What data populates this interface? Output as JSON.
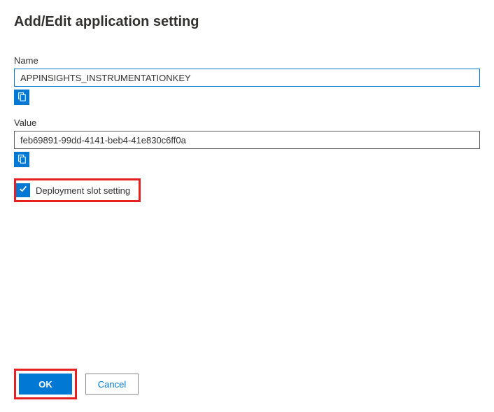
{
  "dialog": {
    "title": "Add/Edit application setting"
  },
  "fields": {
    "name": {
      "label": "Name",
      "value": "APPINSIGHTS_INSTRUMENTATIONKEY"
    },
    "value": {
      "label": "Value",
      "value": "feb69891-99dd-4141-beb4-41e830c6ff0a"
    }
  },
  "checkbox": {
    "deployment_slot": {
      "label": "Deployment slot setting",
      "checked": true
    }
  },
  "buttons": {
    "ok": "OK",
    "cancel": "Cancel"
  },
  "icons": {
    "close": "close-icon",
    "copy": "copy-icon",
    "check": "check-icon"
  }
}
